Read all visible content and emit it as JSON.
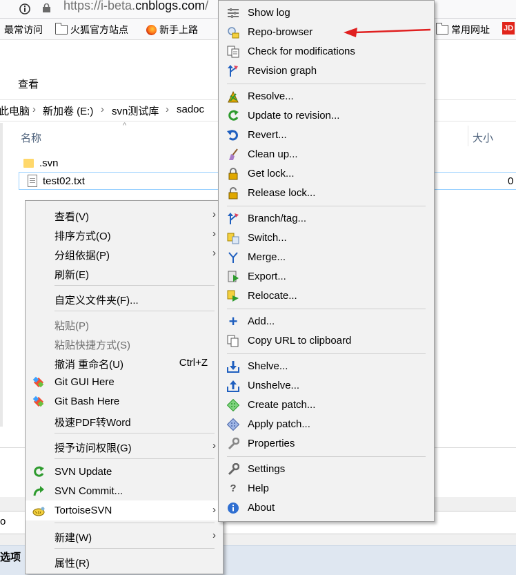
{
  "browser": {
    "url_prefix": "https://i-beta.",
    "url_domain": "cnblogs.com",
    "url_suffix": "/",
    "bookmarks": [
      {
        "label": "最常访问",
        "icon": "none"
      },
      {
        "label": "火狐官方站点",
        "icon": "folder-icon"
      },
      {
        "label": "新手上路",
        "icon": "firefox-icon"
      },
      {
        "label": "常用网址",
        "icon": "folder-icon"
      },
      {
        "label": "JD",
        "icon": "jd-icon"
      }
    ]
  },
  "explorer": {
    "ribbon_tab": "查看",
    "breadcrumb": [
      "此电脑",
      "新加卷 (E:)",
      "svn测试库",
      "sadoc"
    ],
    "breadcrumb_sep": "›",
    "columns": {
      "name": "名称",
      "size": "大小"
    },
    "files": [
      {
        "name": ".svn",
        "type": "folder",
        "size": ""
      },
      {
        "name": "test02.txt",
        "type": "text",
        "size": "0"
      }
    ],
    "lower_fragment": "o",
    "options_fragment": "选项"
  },
  "context_menu": {
    "items": [
      {
        "label": "查看(V)",
        "submenu": true
      },
      {
        "label": "排序方式(O)",
        "submenu": true
      },
      {
        "label": "分组依据(P)",
        "submenu": true
      },
      {
        "label": "刷新(E)"
      },
      {
        "label": "自定义文件夹(F)..."
      },
      {
        "label": "粘贴(P)",
        "disabled": true
      },
      {
        "label": "粘贴快捷方式(S)",
        "disabled": true
      },
      {
        "label": "撤消 重命名(U)",
        "shortcut": "Ctrl+Z"
      },
      {
        "label": "Git GUI Here",
        "icon": "git-icon"
      },
      {
        "label": "Git Bash Here",
        "icon": "git-icon"
      },
      {
        "label": "极速PDF转Word"
      },
      {
        "label": "授予访问权限(G)",
        "submenu": true
      },
      {
        "label": "SVN Update",
        "icon": "svn-update-icon"
      },
      {
        "label": "SVN Commit...",
        "icon": "svn-commit-icon"
      },
      {
        "label": "TortoiseSVN",
        "icon": "tortoisesvn-icon",
        "submenu": true
      },
      {
        "label": "新建(W)",
        "submenu": true
      },
      {
        "label": "属性(R)"
      }
    ]
  },
  "tortoise_menu": {
    "items": [
      {
        "label": "Show log",
        "icon": "show-log-icon"
      },
      {
        "label": "Repo-browser",
        "icon": "repo-browser-icon"
      },
      {
        "label": "Check for modifications",
        "icon": "check-modifications-icon"
      },
      {
        "label": "Revision graph",
        "icon": "revision-graph-icon"
      },
      {
        "label": "Resolve...",
        "icon": "resolve-icon"
      },
      {
        "label": "Update to revision...",
        "icon": "update-revision-icon"
      },
      {
        "label": "Revert...",
        "icon": "revert-icon"
      },
      {
        "label": "Clean up...",
        "icon": "cleanup-icon"
      },
      {
        "label": "Get lock...",
        "icon": "get-lock-icon"
      },
      {
        "label": "Release lock...",
        "icon": "release-lock-icon"
      },
      {
        "label": "Branch/tag...",
        "icon": "branch-tag-icon"
      },
      {
        "label": "Switch...",
        "icon": "switch-icon"
      },
      {
        "label": "Merge...",
        "icon": "merge-icon"
      },
      {
        "label": "Export...",
        "icon": "export-icon"
      },
      {
        "label": "Relocate...",
        "icon": "relocate-icon"
      },
      {
        "label": "Add...",
        "icon": "add-icon"
      },
      {
        "label": "Copy URL to clipboard",
        "icon": "copy-url-icon"
      },
      {
        "label": "Shelve...",
        "icon": "shelve-icon"
      },
      {
        "label": "Unshelve...",
        "icon": "unshelve-icon"
      },
      {
        "label": "Create patch...",
        "icon": "create-patch-icon"
      },
      {
        "label": "Apply patch...",
        "icon": "apply-patch-icon"
      },
      {
        "label": "Properties",
        "icon": "properties-icon"
      },
      {
        "label": "Settings",
        "icon": "settings-icon"
      },
      {
        "label": "Help",
        "icon": "help-icon"
      },
      {
        "label": "About",
        "icon": "about-icon"
      }
    ]
  },
  "colors": {
    "menu_bg": "#f2f2f2",
    "annotation_arrow": "#e02020",
    "svn_green": "#2e9b2e",
    "svn_blue": "#1f5fbf"
  },
  "glyphs": {
    "submenu_arrow": "›",
    "plus": "+",
    "question": "?",
    "info": "i"
  }
}
